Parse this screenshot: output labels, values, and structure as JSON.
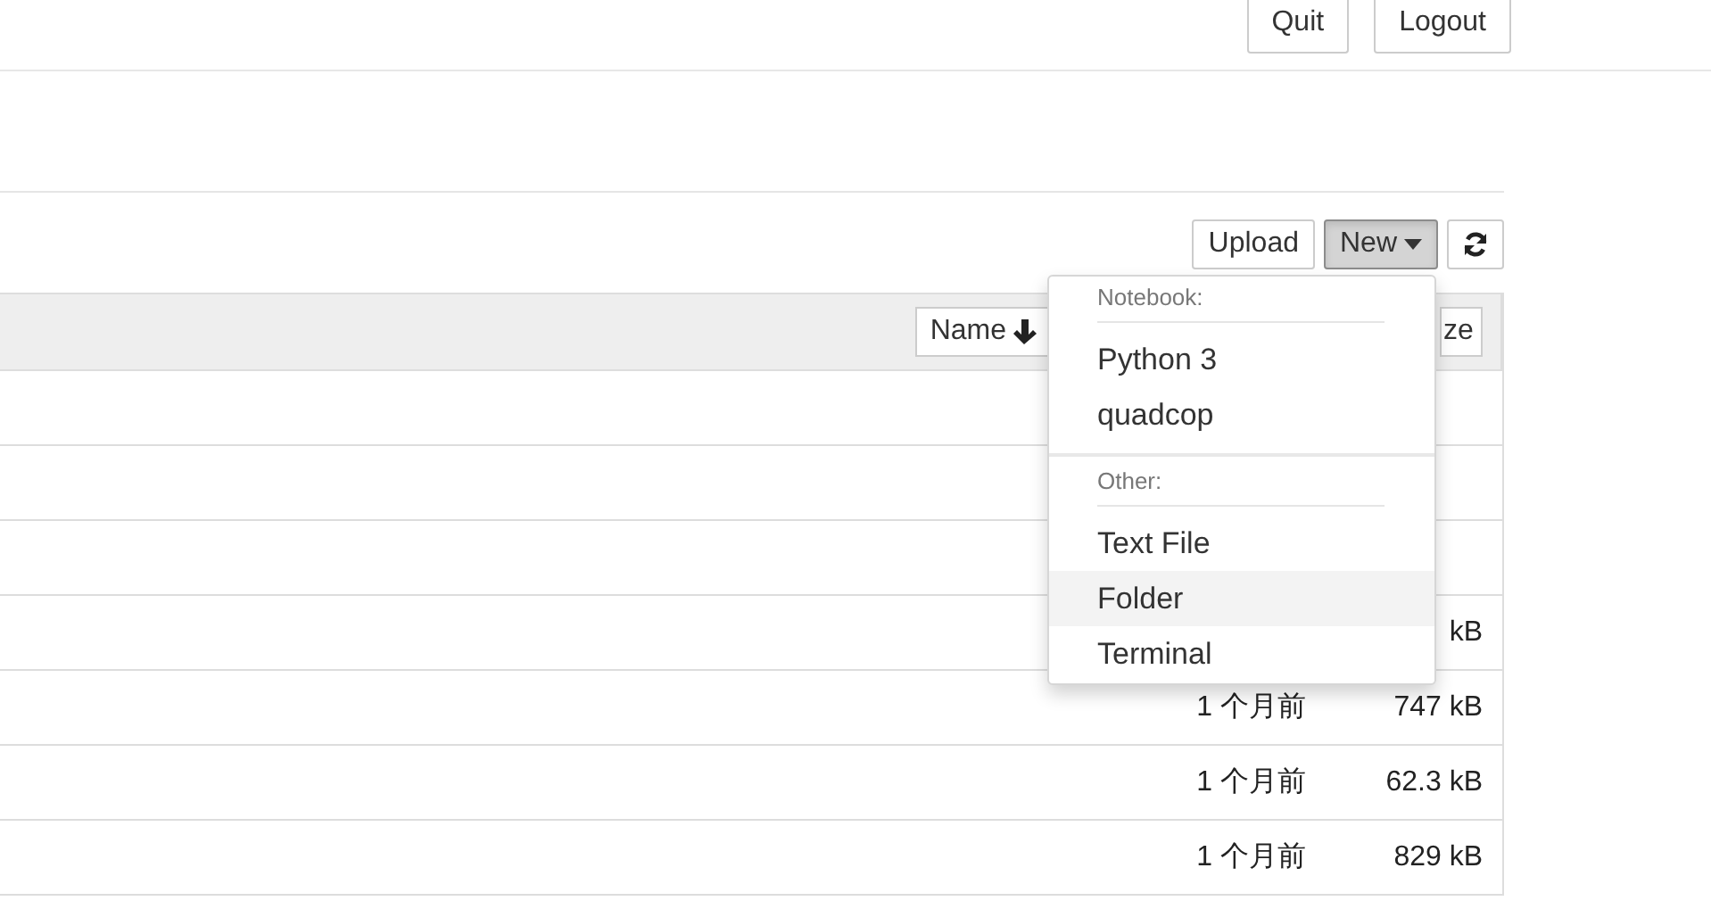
{
  "header": {
    "buttons": [
      "Quit",
      "Logout"
    ]
  },
  "toolbar": {
    "buttons": [
      {
        "kind": "text",
        "label": "Upload",
        "pressed": false
      },
      {
        "kind": "dropdown",
        "label": "New",
        "pressed": true
      },
      {
        "kind": "refresh",
        "pressed": false
      }
    ]
  },
  "table": {
    "columns": [
      {
        "kind": "sort",
        "label": "Name"
      },
      {
        "kind": "plain",
        "label": "ze"
      }
    ],
    "rows": [
      {},
      {},
      {},
      {
        "size": "kB"
      },
      {
        "modified": "1 个月前",
        "size": "747 kB"
      },
      {
        "modified": "1 个月前",
        "size": "62.3 kB"
      },
      {
        "modified": "1 个月前",
        "size": "829 kB"
      }
    ]
  },
  "menu": {
    "items": [
      {
        "kind": "header",
        "label": "Notebook:"
      },
      {
        "kind": "item",
        "label": "Python 3",
        "highlighted": false
      },
      {
        "kind": "item",
        "label": "quadcop",
        "highlighted": false
      },
      {
        "kind": "divider"
      },
      {
        "kind": "header",
        "label": "Other:"
      },
      {
        "kind": "item",
        "label": "Text File",
        "highlighted": false
      },
      {
        "kind": "item",
        "label": "Folder",
        "highlighted": true
      },
      {
        "kind": "item",
        "label": "Terminal",
        "highlighted": false
      }
    ]
  }
}
